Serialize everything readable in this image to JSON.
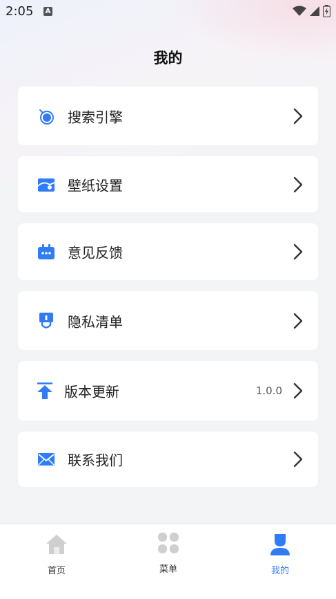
{
  "status_bar": {
    "time": "2:05",
    "notification_icon": "a-letter-icon"
  },
  "page": {
    "title": "我的"
  },
  "menu": [
    {
      "label": "搜索引擎",
      "icon": "search-engine-icon",
      "value": ""
    },
    {
      "label": "壁纸设置",
      "icon": "wallpaper-icon",
      "value": ""
    },
    {
      "label": "意见反馈",
      "icon": "feedback-icon",
      "value": ""
    },
    {
      "label": "隐私清单",
      "icon": "privacy-icon",
      "value": ""
    },
    {
      "label": "版本更新",
      "icon": "update-icon",
      "value": "1.0.0"
    },
    {
      "label": "联系我们",
      "icon": "mail-icon",
      "value": ""
    }
  ],
  "bottom_nav": [
    {
      "label": "首页",
      "icon": "home-icon"
    },
    {
      "label": "菜单",
      "icon": "menu-grid-icon"
    },
    {
      "label": "我的",
      "icon": "profile-icon"
    }
  ],
  "colors": {
    "accent": "#2f7cf6",
    "inactive_icon": "#cfcfcf",
    "background": "#f3f4f6"
  }
}
